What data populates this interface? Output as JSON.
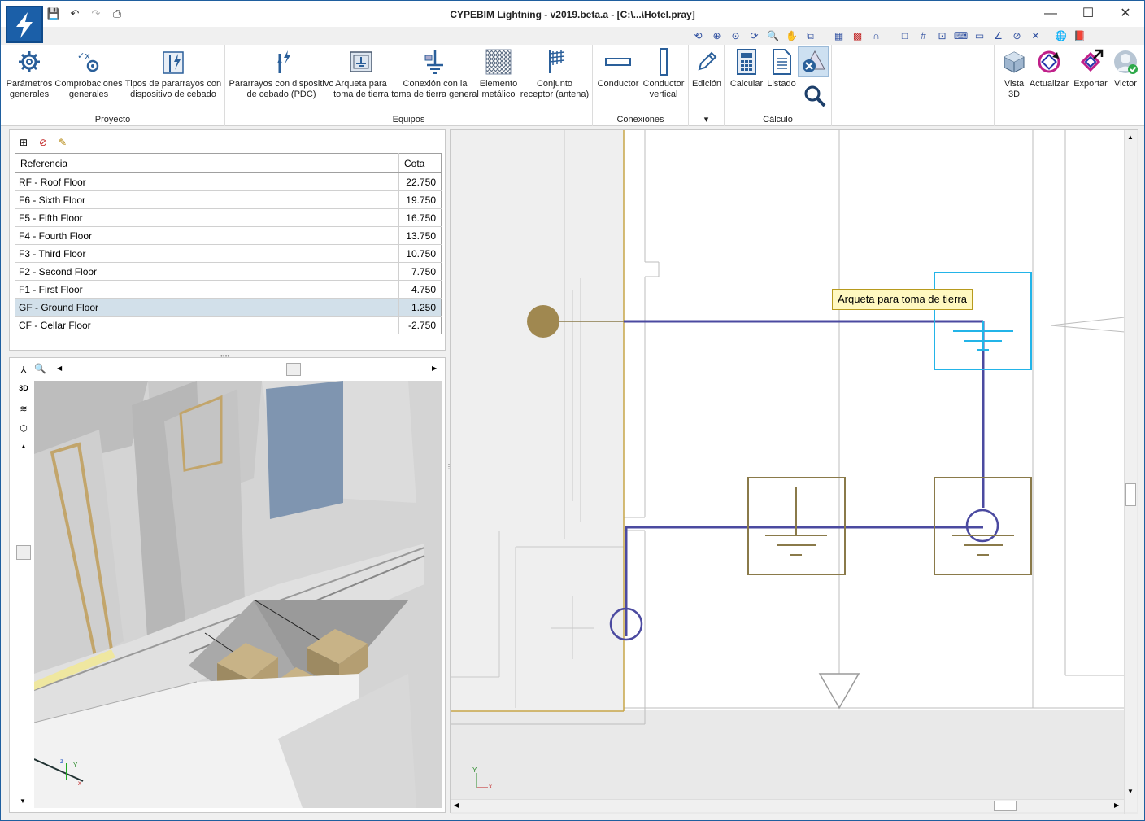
{
  "titlebar": {
    "title": "CYPEBIM Lightning - v2019.beta.a - [C:\\...\\Hotel.pray]",
    "minimize": "—",
    "maximize": "☐",
    "close": "✕"
  },
  "ribbon": {
    "groups": {
      "proyecto": "Proyecto",
      "equipos": "Equipos",
      "conexiones": "Conexiones",
      "calculo": "Cálculo"
    },
    "buttons": {
      "parametros": [
        "Parámetros",
        "generales"
      ],
      "comprobaciones": [
        "Comprobaciones",
        "generales"
      ],
      "tipos": [
        "Tipos de pararrayos con",
        "dispositivo de cebado"
      ],
      "pararrayos": [
        "Pararrayos con dispositivo",
        "de cebado (PDC)"
      ],
      "arqueta": [
        "Arqueta para",
        "toma de tierra"
      ],
      "conexion": [
        "Conexión con la",
        "toma de tierra general"
      ],
      "elemento": [
        "Elemento",
        "metálico"
      ],
      "conjunto": [
        "Conjunto",
        "receptor (antena)"
      ],
      "conductor": "Conductor",
      "conductor_vertical": [
        "Conductor",
        "vertical"
      ],
      "edicion": "Edición",
      "calcular": "Calcular",
      "listado": "Listado",
      "vista3d": [
        "Vista",
        "3D"
      ],
      "actualizar": "Actualizar",
      "exportar": "Exportar",
      "user": "Victor"
    }
  },
  "floors": {
    "headers": {
      "referencia": "Referencia",
      "cota": "Cota"
    },
    "rows": [
      {
        "ref": "RF - Roof Floor",
        "cota": "22.750"
      },
      {
        "ref": "F6 - Sixth Floor",
        "cota": "19.750"
      },
      {
        "ref": "F5 - Fifth Floor",
        "cota": "16.750"
      },
      {
        "ref": "F4 - Fourth Floor",
        "cota": "13.750"
      },
      {
        "ref": "F3 - Third Floor",
        "cota": "10.750"
      },
      {
        "ref": "F2 - Second Floor",
        "cota": "7.750"
      },
      {
        "ref": "F1 - First Floor",
        "cota": "4.750"
      },
      {
        "ref": "GF - Ground Floor",
        "cota": "1.250"
      },
      {
        "ref": "CF - Cellar Floor",
        "cota": "-2.750"
      }
    ],
    "selected_index": 7
  },
  "plan": {
    "tooltip": "Arqueta para toma de tierra",
    "axis_x": "x",
    "axis_y": "Y"
  },
  "view3d": {
    "axis_x": "x",
    "axis_y": "Y",
    "axis_z": "z"
  },
  "colors": {
    "accent_blue": "#1b5fa8",
    "conductor": "#4b4aa0",
    "earth": "#8a7a4a",
    "selection": "#23b4e8"
  }
}
